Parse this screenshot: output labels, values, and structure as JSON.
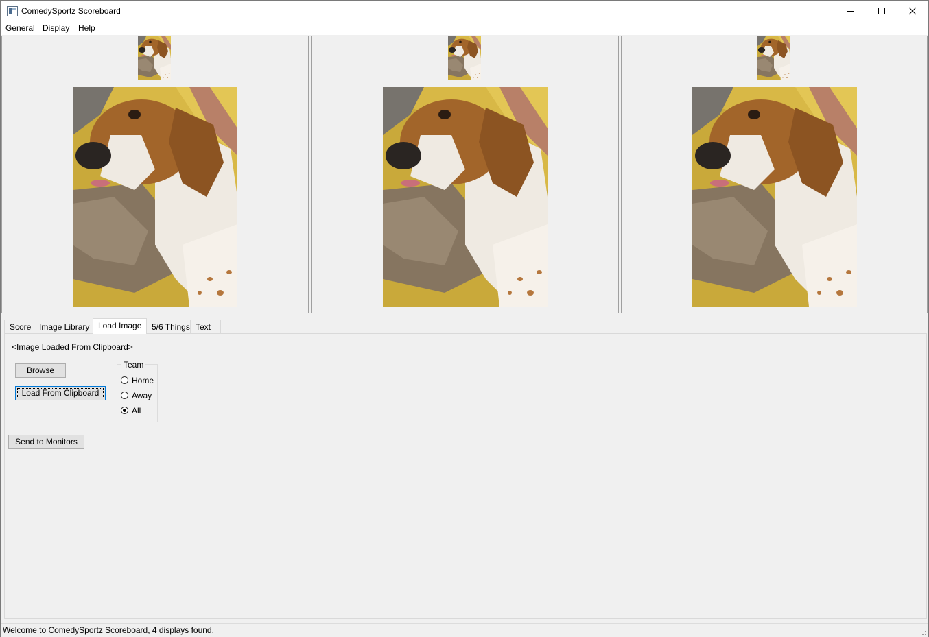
{
  "window": {
    "title": "ComedySportz Scoreboard",
    "minimize_icon": "minimize-icon",
    "maximize_icon": "maximize-icon",
    "close_icon": "close-icon"
  },
  "menu": {
    "general": {
      "mnemonic": "G",
      "rest": "eneral"
    },
    "display": {
      "mnemonic": "D",
      "rest": "isplay"
    },
    "help": {
      "mnemonic": "H",
      "rest": "elp"
    }
  },
  "monitors": [
    {
      "name": "monitor-1",
      "image": "beagle-photo"
    },
    {
      "name": "monitor-2",
      "image": "beagle-photo"
    },
    {
      "name": "monitor-3",
      "image": "beagle-photo"
    }
  ],
  "tabs": [
    {
      "label": "Score",
      "active": false
    },
    {
      "label": "Image Library",
      "active": false
    },
    {
      "label": "Load Image",
      "active": true
    },
    {
      "label": "5/6 Things",
      "active": false
    },
    {
      "label": "Text",
      "active": false
    }
  ],
  "load_image": {
    "source_label": "<Image Loaded From Clipboard>",
    "browse_label": "Browse",
    "clipboard_label": "Load From Clipboard",
    "send_label": "Send to Monitors",
    "team_group": {
      "title": "Team",
      "options": [
        {
          "label": "Home",
          "checked": false
        },
        {
          "label": "Away",
          "checked": false
        },
        {
          "label": "All",
          "checked": true
        }
      ]
    }
  },
  "statusbar": {
    "message": "Welcome to ComedySportz Scoreboard, 4 displays found."
  },
  "colors": {
    "background": "#f0f0f0",
    "button_face": "#e1e1e1",
    "focus_accent": "#0078d7"
  }
}
